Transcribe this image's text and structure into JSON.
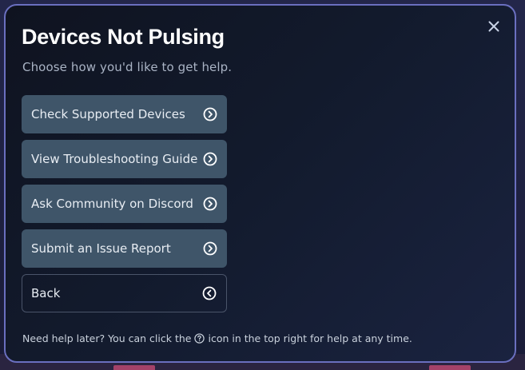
{
  "modal": {
    "title": "Devices Not Pulsing",
    "subtitle": "Choose how you'd like to get help.",
    "close_icon": "close-icon",
    "options": [
      {
        "label": "Check Supported Devices",
        "icon": "chevron-right-circle-icon"
      },
      {
        "label": "View Troubleshooting Guide",
        "icon": "chevron-right-circle-icon"
      },
      {
        "label": "Ask Community on Discord",
        "icon": "chevron-right-circle-icon"
      },
      {
        "label": "Submit an Issue Report",
        "icon": "chevron-right-circle-icon"
      },
      {
        "label": "Back",
        "icon": "chevron-left-circle-icon"
      }
    ],
    "footer": {
      "before": "Need help later? You can click the",
      "icon": "help-circle-icon",
      "after": "icon in the top right for help at any time."
    }
  },
  "colors": {
    "modal_border": "#6a6fbf",
    "option_bg": "#3f5569",
    "title": "#ffffff",
    "subtitle": "#a9b3c4"
  }
}
